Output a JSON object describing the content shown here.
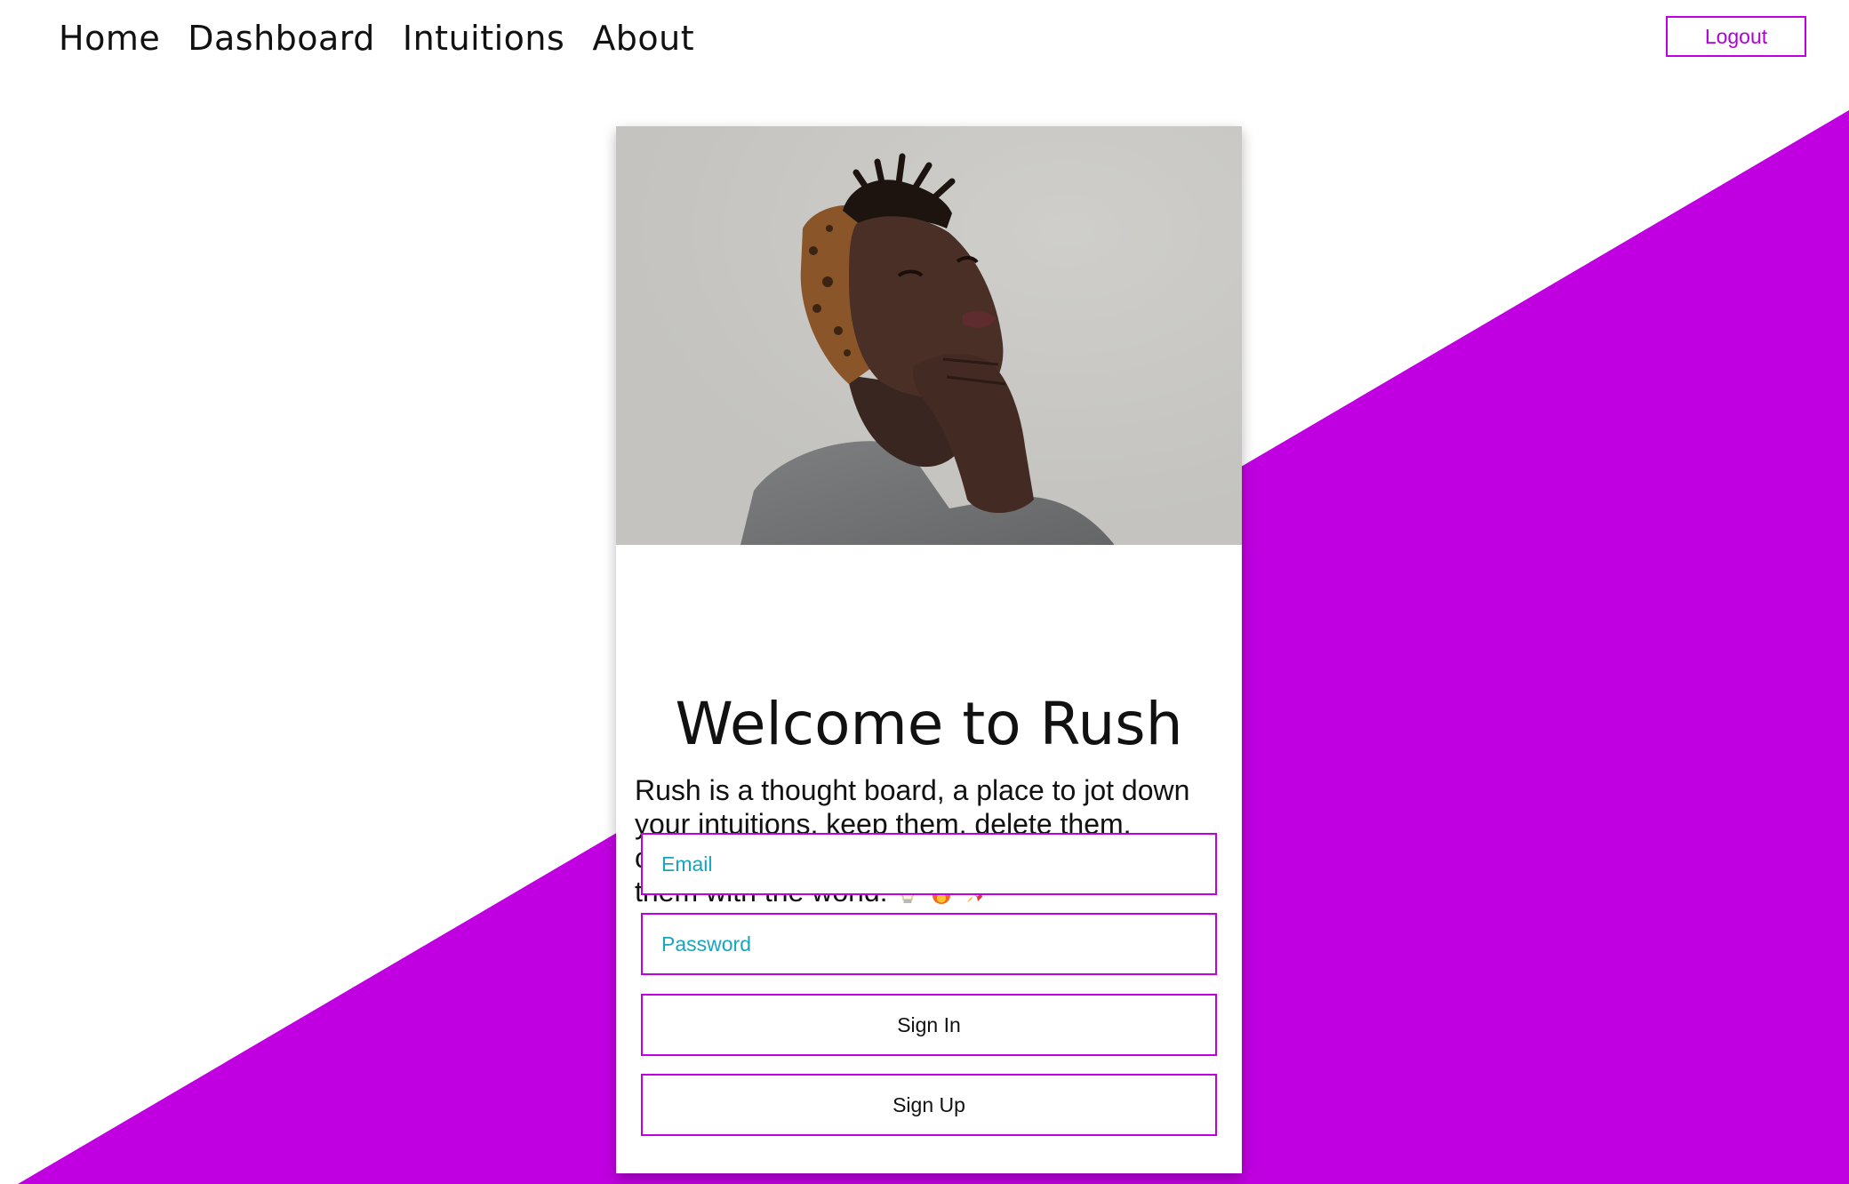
{
  "colors": {
    "accent": "#c000e0",
    "placeholder": "#17a5bf",
    "text": "#111111",
    "background": "#ffffff"
  },
  "nav": {
    "items": [
      {
        "label": "Home"
      },
      {
        "label": "Dashboard"
      },
      {
        "label": "Intuitions"
      },
      {
        "label": "About"
      }
    ],
    "logout_label": "Logout"
  },
  "card": {
    "image_icon": "portrait-photo",
    "title": "Welcome to Rush",
    "description": "Rush is a thought board, a place to jot down your intuitions, keep them, delete them, cultivate them, and should you desire, share them with the world:",
    "emojis": [
      "lightbulb-icon",
      "fire-icon",
      "rocket-icon"
    ],
    "email_placeholder": "Email",
    "password_placeholder": "Password",
    "signin_label": "Sign In",
    "signup_label": "Sign Up"
  }
}
